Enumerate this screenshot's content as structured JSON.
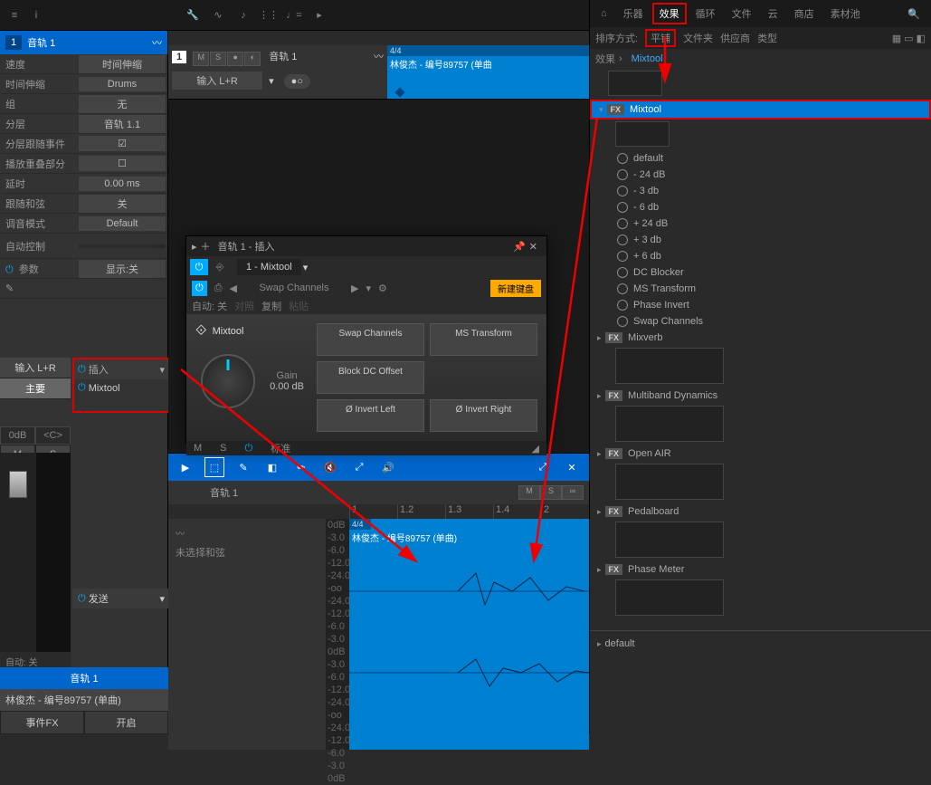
{
  "topbar": {
    "home": "⌂",
    "info": "i"
  },
  "ruler": {
    "marks": [
      "1.2",
      "1.3",
      "1.4"
    ]
  },
  "ruler2": {
    "marks": [
      "1",
      "1.2",
      "1.3",
      "1.4",
      "2"
    ]
  },
  "track": {
    "number": "1",
    "name": "音轨 1"
  },
  "miniTrack": {
    "number": "1",
    "name": "音轨 1",
    "input": "输入 L+R",
    "clipName": "林俊杰 - 编号89757 (单曲",
    "timeSig": "4/4"
  },
  "props": {
    "speed_label": "速度",
    "speed_value": "时间伸缩",
    "timestretch_label": "时间伸缩",
    "timestretch_value": "Drums",
    "group_label": "组",
    "group_value": "无",
    "layers_label": "分层",
    "layers_value": "音轨 1.1",
    "layerFollow_label": "分层跟随事件",
    "playOverlap_label": "播放重叠部分",
    "delay_label": "延时",
    "delay_value": "0.00 ms",
    "followChord_label": "跟随和弦",
    "followChord_value": "关",
    "tuneModeLabel": "调音模式",
    "tuneModeValue": "Default",
    "autoCtrl_label": "自动控制",
    "params_label": "参数",
    "params_value": "显示:关"
  },
  "channel": {
    "input": "输入 L+R",
    "main": "主要",
    "db": "0dB",
    "center": "<C>",
    "m": "M",
    "s": "S",
    "send": "发送",
    "autoOff": "自动: 关"
  },
  "insert": {
    "header": "插入",
    "item": "Mixtool"
  },
  "plugin": {
    "title": "音轨 1 - 插入",
    "tabName": "1 - Mixtool",
    "autoOff": "自动: 关",
    "presetName": "Swap Channels",
    "compare": "对照",
    "copy": "复制",
    "paste": "粘贴",
    "newMidi": "新建键盘",
    "brand": "Mixtool",
    "gainLabel": "Gain",
    "gainValue": "0.00 dB",
    "swapBtn": "Swap Channels",
    "msBtn": "MS Transform",
    "blockDC": "Block DC Offset",
    "invL": "Ø Invert Left",
    "invR": "Ø Invert Right",
    "footer_m": "M",
    "footer_s": "S",
    "footer_std": "标准"
  },
  "editor": {
    "trackName": "音轨 1",
    "noChord": "未选择和弦",
    "clip": "林俊杰 - 编号89757 (单曲)",
    "timeSig": "4/4",
    "dbMarks": [
      "0dB",
      "-3.0",
      "-6.0",
      "-12.0",
      "-24.0",
      "-oo",
      "-24.0",
      "-12.0",
      "-6.0",
      "-3.0",
      "0dB",
      "-3.0",
      "-6.0",
      "-12.0",
      "-24.0",
      "-oo",
      "-24.0",
      "-12.0",
      "-6.0",
      "-3.0",
      "0dB"
    ]
  },
  "bottom": {
    "trackName": "音轨 1",
    "fileName": "林俊杰 - 编号89757 (单曲)",
    "eventFx": "事件FX",
    "open": "开启"
  },
  "browser": {
    "tabs": {
      "home": "⌂",
      "instruments": "乐器",
      "effects": "效果",
      "loops": "循环",
      "files": "文件",
      "cloud": "云",
      "store": "商店",
      "pool": "素材池"
    },
    "sort": {
      "label": "排序方式:",
      "tile": "平铺",
      "folder": "文件夹",
      "vendor": "供应商",
      "type": "类型"
    },
    "crumb_root": "效果",
    "crumb_current": "Mixtool",
    "selected": "Mixtool",
    "presets": [
      "default",
      "- 24 dB",
      "- 3 db",
      "- 6 db",
      "+ 24 dB",
      "+ 3 db",
      "+ 6 db",
      "DC Blocker",
      "MS Transform",
      "Phase Invert",
      "Swap Channels"
    ],
    "items": [
      {
        "name": "Mixverb"
      },
      {
        "name": "Multiband Dynamics"
      },
      {
        "name": "Open AIR"
      },
      {
        "name": "Pedalboard"
      },
      {
        "name": "Phase Meter"
      }
    ],
    "bottomDefault": "default"
  }
}
